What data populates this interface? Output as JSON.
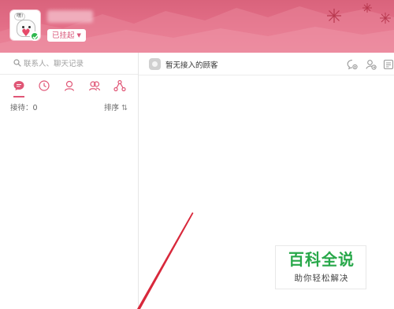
{
  "header": {
    "avatar_bubble_text": "嘿!",
    "status_label": "已挂起",
    "colors": {
      "bg_top": "#d9637c",
      "bg_bottom": "#ec7d93",
      "online": "#2db84d"
    }
  },
  "left_panel": {
    "search": {
      "placeholder": "联系人、聊天记录"
    },
    "tabs": [
      {
        "name": "chat",
        "icon": "chat-bubble-icon",
        "active": true
      },
      {
        "name": "history",
        "icon": "clock-icon",
        "active": false
      },
      {
        "name": "contact",
        "icon": "person-icon",
        "active": false
      },
      {
        "name": "group",
        "icon": "people-icon",
        "active": false
      },
      {
        "name": "structure",
        "icon": "network-icon",
        "active": false
      }
    ],
    "queue": {
      "receiving_label": "接待：0",
      "sort_label": "排序",
      "sort_icon": "sort-arrows-icon"
    }
  },
  "right_panel": {
    "chat_header": {
      "status_text": "暂无接入的顾客"
    },
    "tools": [
      "chat-plus-icon",
      "transfer-icon",
      "note-icon"
    ]
  },
  "watermark": {
    "title": "百科全说",
    "subtitle": "助你轻松解决"
  },
  "accent_color": "#e05676"
}
